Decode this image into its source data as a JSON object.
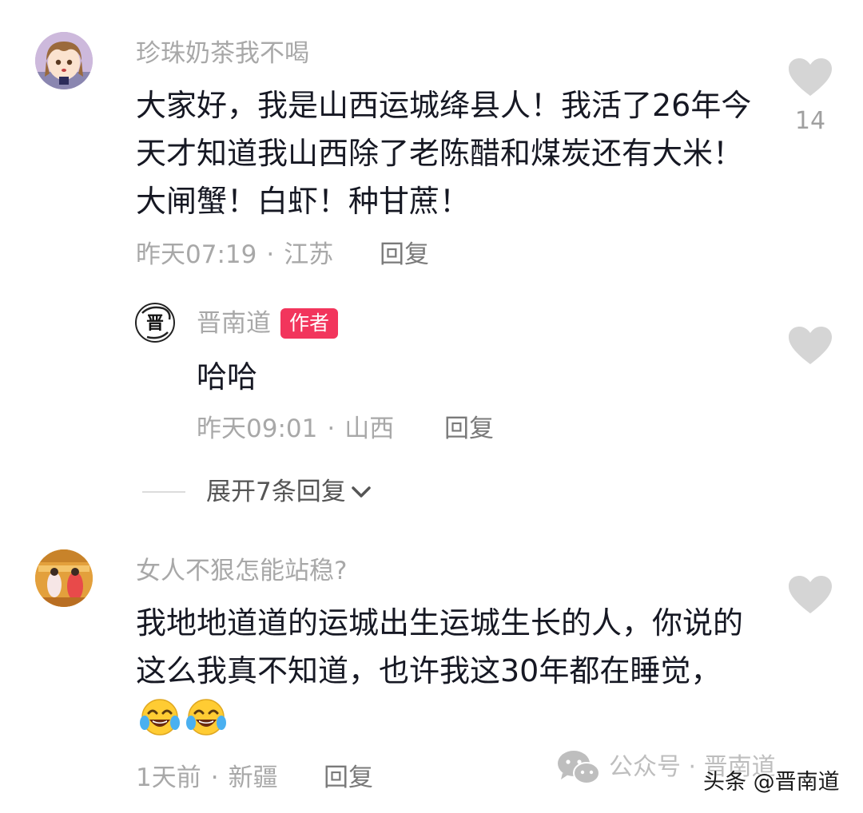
{
  "comments": [
    {
      "username": "珍珠奶茶我不喝",
      "content": "大家好，我是山西运城绛县人！我活了26年今天才知道我山西除了老陈醋和煤炭还有大米！大闸蟹！白虾！种甘蔗！",
      "time": "昨天07:19",
      "location": "江苏",
      "reply_label": "回复",
      "like_count": "14",
      "replies": [
        {
          "username": "晋南道",
          "badge": "作者",
          "avatar_char": "晋",
          "content": "哈哈",
          "time": "昨天09:01",
          "location": "山西",
          "reply_label": "回复"
        }
      ],
      "expand_label": "展开7条回复"
    },
    {
      "username": "女人不狠怎能站稳?",
      "content": "我地地道道的运城出生运城生长的人，你说的这么我真不知道，也许我这30年都在睡觉，",
      "time": "1天前",
      "location": "新疆",
      "reply_label": "回复"
    }
  ],
  "separator": "·",
  "watermark": {
    "wechat": "公众号 · 晋南道",
    "toutiao": "头条 @晋南道"
  },
  "colors": {
    "author_badge": "#f2355c",
    "meta_text": "#a8a8a8",
    "like_icon": "#d5d5d5"
  },
  "icons": [
    "heart-icon",
    "chevron-down-icon",
    "laughing-crying-emoji",
    "wechat-icon"
  ]
}
